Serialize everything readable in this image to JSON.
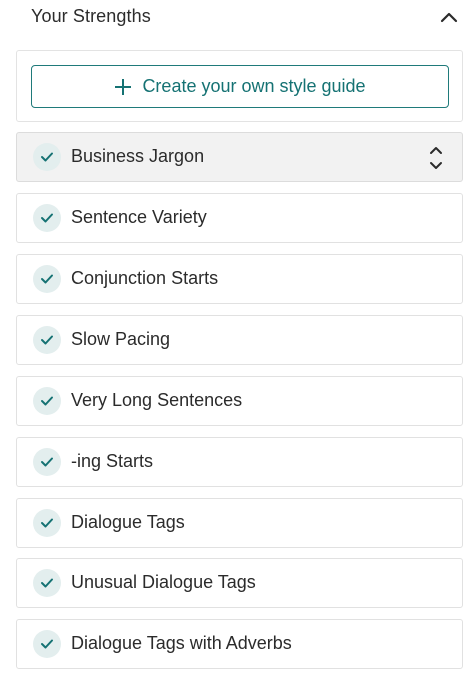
{
  "header": {
    "title": "Your Strengths",
    "collapse_icon": "chevron-up-icon"
  },
  "panel": {
    "create_button_label": "Create your own style guide",
    "create_button_icon": "plus-icon"
  },
  "colors": {
    "accent": "#157273",
    "check_bg": "#e3eeee",
    "active_item_bg": "#f2f2f2",
    "border": "#e1e1e1"
  },
  "items": [
    {
      "label": "Business Jargon",
      "icon": "check-icon",
      "active": true
    },
    {
      "label": "Sentence Variety",
      "icon": "check-icon"
    },
    {
      "label": "Conjunction Starts",
      "icon": "check-icon"
    },
    {
      "label": "Slow Pacing",
      "icon": "check-icon"
    },
    {
      "label": "Very Long Sentences",
      "icon": "check-icon"
    },
    {
      "label": "-ing Starts",
      "icon": "check-icon"
    },
    {
      "label": "Dialogue Tags",
      "icon": "check-icon"
    },
    {
      "label": "Unusual Dialogue Tags",
      "icon": "check-icon"
    },
    {
      "label": "Dialogue Tags with Adverbs",
      "icon": "check-icon"
    }
  ]
}
